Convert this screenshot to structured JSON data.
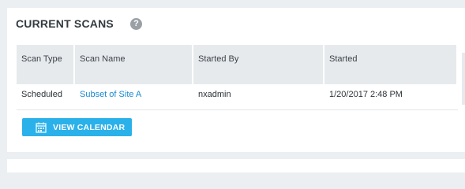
{
  "header": {
    "title": "CURRENT SCANS",
    "help_glyph": "?"
  },
  "table": {
    "columns": [
      "Scan Type",
      "Scan Name",
      "Started By",
      "Started"
    ],
    "rows": [
      {
        "scan_type": "Scheduled",
        "scan_name": "Subset of Site A",
        "started_by": "nxadmin",
        "started": "1/20/2017 2:48 PM"
      }
    ]
  },
  "actions": {
    "view_calendar_label": "VIEW CALENDAR",
    "icon": "calendar-icon"
  },
  "colors": {
    "accent": "#2bb1ea",
    "link": "#1a8ad0",
    "header_bg": "#e7eaed",
    "page_bg": "#eceff1"
  }
}
